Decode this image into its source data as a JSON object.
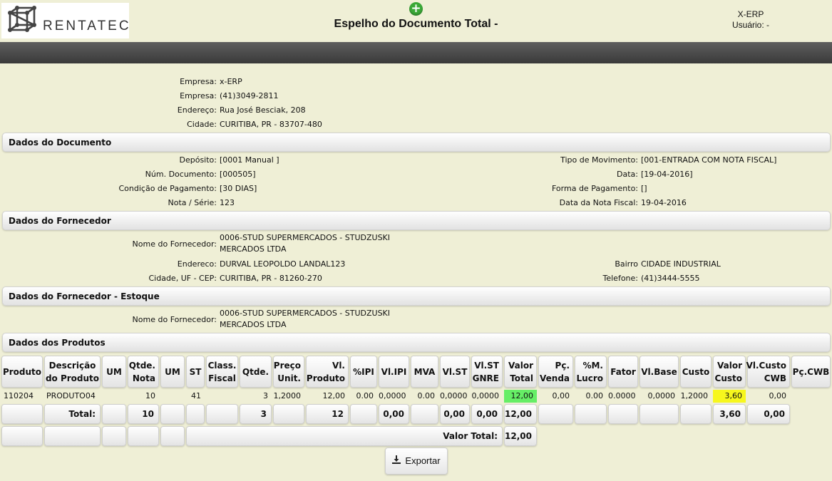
{
  "header": {
    "logo_text": "RENTATEC",
    "add_icon": "plus-circle-icon",
    "title": "Espelho do Documento Total -",
    "system": "X-ERP",
    "user": "Usuário: -"
  },
  "company": [
    {
      "label": "Empresa:",
      "value": "x-ERP"
    },
    {
      "label": "Empresa:",
      "value": "(41)3049-2811"
    },
    {
      "label": "Endereço:",
      "value": "Rua José Besciak, 208"
    },
    {
      "label": "Cidade:",
      "value": "CURITIBA, PR - 83707-480"
    }
  ],
  "documento": {
    "title": "Dados do Documento",
    "left": [
      {
        "label": "Depósito:",
        "value": "[0001 Manual ]"
      },
      {
        "label": "Núm. Documento:",
        "value": "[000505]"
      },
      {
        "label": "Condição de Pagamento:",
        "value": "[30 DIAS]"
      },
      {
        "label": "Nota / Série:",
        "value": "123"
      }
    ],
    "right": [
      {
        "label": "Tipo de Movimento:",
        "value": "[001-ENTRADA COM NOTA FISCAL]"
      },
      {
        "label": "Data:",
        "value": "[19-04-2016]"
      },
      {
        "label": "Forma de Pagamento:",
        "value": "[]"
      },
      {
        "label": "Data da Nota Fiscal:",
        "value": "19-04-2016"
      }
    ]
  },
  "fornecedor": {
    "title": "Dados do Fornecedor",
    "nome_label": "Nome do Fornecedor:",
    "nome_value": "0006-STUD SUPERMERCADOS - STUDZUSKI MERCADOS LTDA",
    "endereco_label": "Endereco:",
    "endereco_value": "DURVAL LEOPOLDO LANDAL123",
    "cidade_label": "Cidade, UF - CEP:",
    "cidade_value": "CURITIBA, PR - 81260-270",
    "bairro_label": "Bairro",
    "bairro_value": "CIDADE INDUSTRIAL",
    "telefone_label": "Telefone:",
    "telefone_value": "(41)3444-5555"
  },
  "fornecedor_estoque": {
    "title": "Dados do Fornecedor - Estoque",
    "nome_label": "Nome do Fornecedor:",
    "nome_value": "0006-STUD SUPERMERCADOS - STUDZUSKI MERCADOS LTDA"
  },
  "produtos": {
    "title": "Dados dos Produtos",
    "columns": [
      "Produto",
      "Descrição do Produto",
      "UM",
      "Qtde. Nota",
      "UM",
      "ST",
      "Class. Fiscal",
      "Qtde.",
      "Preço Unit.",
      "Vl. Produto",
      "%IPI",
      "Vl.IPI",
      "MVA",
      "Vl.ST",
      "Vl.ST GNRE",
      "Valor Total",
      "Pç. Venda",
      "%M. Lucro",
      "Fator",
      "Vl.Base",
      "Custo",
      "Valor Custo",
      "Vl.Custo CWB",
      "Pç.CWB"
    ],
    "rows": [
      [
        "110204",
        "PRODUTO04",
        "",
        "10",
        "",
        "41",
        "",
        "3",
        "1,2000",
        "12,00",
        "0.00",
        "0,0000",
        "0.00",
        "0,0000",
        "0,0000",
        "12,00",
        "0,00",
        "0.00",
        "0.0000",
        "0,0000",
        "1,2000",
        "3,60",
        "0,00",
        ""
      ]
    ],
    "highlight_colors": {
      "valor_total": "#66ee66",
      "valor_custo": "#f7f71d"
    },
    "totals": {
      "label": "Total:",
      "qtde_nota": "10",
      "qtde": "3",
      "vl_produto": "12",
      "vl_ipi": "0,00",
      "vl_st": "0,00",
      "vl_st_gnre": "0,00",
      "valor_total": "12,00",
      "valor_custo": "3,60",
      "vl_custo_cwb": "0,00"
    },
    "valor_total_label": "Valor Total:",
    "valor_total_value": "12,00"
  },
  "export": {
    "label": "Exportar",
    "icon": "download-icon"
  }
}
